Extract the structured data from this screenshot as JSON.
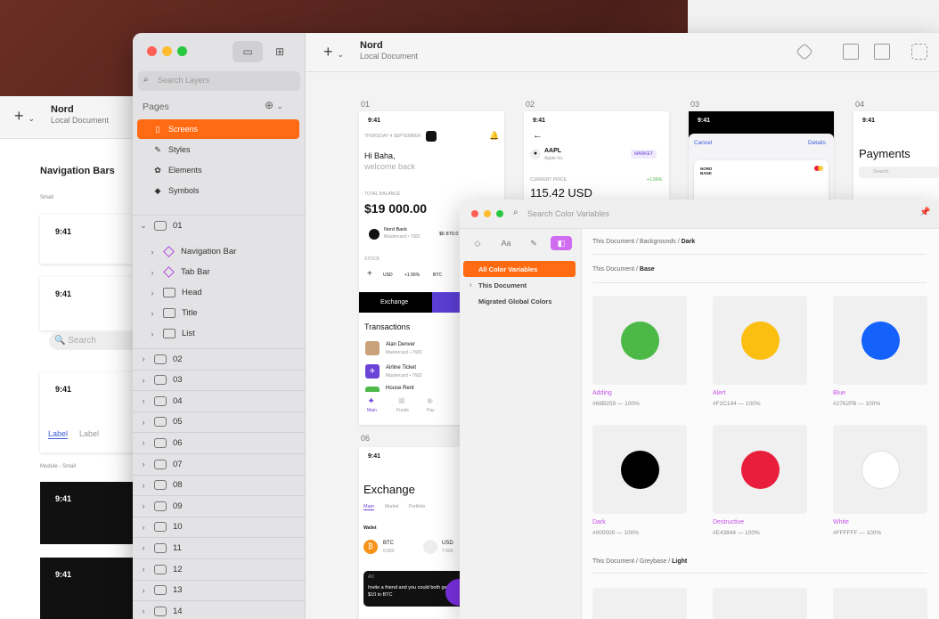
{
  "back_window": {
    "title": "Nord",
    "subtitle": "Local Document",
    "section": "Navigation Bars",
    "small_label": "Small",
    "module_label": "Module - Small",
    "time": "9:41",
    "search": "Search",
    "tab_active": "Label",
    "tab_inactive": "Label"
  },
  "main_window": {
    "title": "Nord",
    "subtitle": "Local Document",
    "search_placeholder": "Search Layers",
    "pages_header": "Pages",
    "pages": [
      {
        "label": "Screens",
        "icon": "phone-icon",
        "selected": true
      },
      {
        "label": "Styles",
        "icon": "brush-icon",
        "selected": false
      },
      {
        "label": "Elements",
        "icon": "elements-icon",
        "selected": false
      },
      {
        "label": "Symbols",
        "icon": "diamond-icon",
        "selected": false
      }
    ],
    "artboard_open": "01",
    "children": [
      {
        "label": "Navigation Bar",
        "icon": "symbol-icon"
      },
      {
        "label": "Tab Bar",
        "icon": "symbol-icon"
      },
      {
        "label": "Head",
        "icon": "folder-icon"
      },
      {
        "label": "Title",
        "icon": "folder-icon"
      },
      {
        "label": "List",
        "icon": "folder-icon"
      }
    ],
    "artboards": [
      "02",
      "03",
      "04",
      "05",
      "06",
      "07",
      "08",
      "09",
      "10",
      "11",
      "12",
      "13",
      "14"
    ]
  },
  "canvas": {
    "artboard_numbers": [
      "01",
      "02",
      "03",
      "04",
      "06"
    ],
    "s1": {
      "time": "9:41",
      "date": "THURSDAY 4 SEPTEMBER",
      "greet1": "Hi Baha,",
      "greet2": "welcome back",
      "balance_label": "TOTAL BALANCE",
      "balance": "$19 000.00",
      "bank": "Nord Bank",
      "card": "Mastercard • 7682",
      "amount": "$6 870.0",
      "stock": "STOCK",
      "usd": "USD",
      "usd_change": "+1.56%",
      "btc": "BTC",
      "btn": "Exchange",
      "transactions": "Transactions",
      "tx": [
        {
          "name": "Alan Denver",
          "sub": "Mastercard • 7682"
        },
        {
          "name": "Airline Ticket",
          "sub": "Mastercard • 7682"
        },
        {
          "name": "House Rent",
          "sub": ""
        }
      ],
      "tabs": [
        "Main",
        "Funds",
        "Pay"
      ]
    },
    "s2": {
      "time": "9:41",
      "ticker": "AAPL",
      "company": "Apple Inc",
      "badge": "MARKET",
      "price_label": "CURRENT PRICE",
      "change": "+1.56%",
      "price": "115.42 USD"
    },
    "s3": {
      "time": "9:41",
      "cancel": "Cancel",
      "details": "Details",
      "bank1": "NORD",
      "bank2": "BANK"
    },
    "s4": {
      "time": "9:41",
      "title": "Payments",
      "search": "Search"
    },
    "s6": {
      "time": "9:41",
      "title": "Exchange",
      "tabs": [
        "Main",
        "Market",
        "Portfolio"
      ],
      "wallet": "Wallet",
      "btc": "BTC",
      "btc_val": "0.003",
      "usd": "USD",
      "usd_val": "7 600",
      "promo_tag": "AD",
      "promo": "Invite a friend and you could both get $10 in BTC"
    }
  },
  "color_panel": {
    "search_placeholder": "Search Color Variables",
    "tab_icons": [
      "diamond-icon",
      "Aa",
      "pen-icon",
      "swatch-icon"
    ],
    "items": [
      {
        "label": "All Color Variables",
        "selected": true
      },
      {
        "label": "This Document",
        "selected": false
      },
      {
        "label": "Migrated Global Colors",
        "selected": false
      }
    ],
    "crumb1": {
      "path": "This Document / Backgrounds / ",
      "leaf": "Dark"
    },
    "crumb2": {
      "path": "This Document / ",
      "leaf": "Base"
    },
    "crumb3": {
      "path": "This Document / Greybase / ",
      "leaf": "Light"
    },
    "swatches": [
      {
        "name": "Adding",
        "value": "#68B259 — 100%",
        "color": "#4cb947"
      },
      {
        "name": "Alert",
        "value": "#F2C144 — 100%",
        "color": "#fbbf12"
      },
      {
        "name": "Blue",
        "value": "#2762FB — 100%",
        "color": "#1462fb"
      },
      {
        "name": "Dark",
        "value": "#000000 — 100%",
        "color": "#000000"
      },
      {
        "name": "Destructive",
        "value": "#E43844 — 100%",
        "color": "#e91e3c"
      },
      {
        "name": "White",
        "value": "#FFFFFF — 100%",
        "color": "#ffffff"
      }
    ]
  }
}
